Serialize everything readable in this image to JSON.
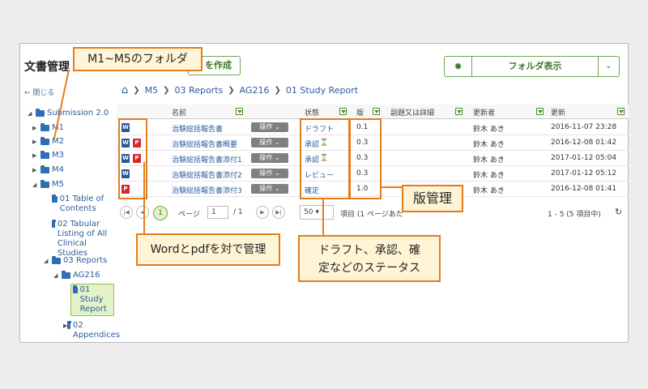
{
  "app": {
    "title": "文書管理",
    "create_label": "を作成",
    "folder_view_label": "フォルダ表示",
    "close_label": "閉じる"
  },
  "breadcrumb": [
    "M5",
    "03 Reports",
    "AG216",
    "01 Study Report"
  ],
  "tree": {
    "submission": "Submission 2.0",
    "m1": "M1",
    "m2": "M2",
    "m3": "M3",
    "m4": "M4",
    "m5": "M5",
    "toc": "01 Table of Contents",
    "tabular": "02 Tabular Listing of All Clinical Studies",
    "reports": "03 Reports",
    "ag216": "AG216",
    "study_report": "01 Study Report",
    "appendices": "02 Appendices"
  },
  "columns": {
    "name": "名前",
    "status": "状態",
    "version": "版",
    "title_detail": "副題又は詳細",
    "updater": "更新者",
    "updated": "更新"
  },
  "op_label": "操作 ⌄",
  "rows": [
    {
      "icons": [
        "W"
      ],
      "name": "治験総括報告書",
      "status": "ドラフト",
      "hourglass": "",
      "version": "0.1",
      "updater": "鈴木 あき",
      "updated": "2016-11-07 23:28"
    },
    {
      "icons": [
        "W",
        "P"
      ],
      "name": "治験総括報告書概要",
      "status": "承認",
      "hourglass": "⌛",
      "version": "0.3",
      "updater": "鈴木 あき",
      "updated": "2016-12-08 01:42"
    },
    {
      "icons": [
        "W",
        "P"
      ],
      "name": "治験総括報告書添付1",
      "status": "承認",
      "hourglass": "⌛",
      "version": "0.3",
      "updater": "鈴木 あき",
      "updated": "2017-01-12 05:04"
    },
    {
      "icons": [
        "W"
      ],
      "name": "治験総括報告書添付2",
      "status": "レビュー",
      "hourglass": "",
      "version": "0.3",
      "updater": "鈴木 あき",
      "updated": "2017-01-12 05:12"
    },
    {
      "icons": [
        "P"
      ],
      "name": "治験総括報告書添付3",
      "status": "確定",
      "hourglass": "",
      "version": "1.0",
      "updater": "鈴木 あき",
      "updated": "2016-12-08 01:41"
    }
  ],
  "pager": {
    "current": "1",
    "page_label": "ページ",
    "page_value": "1",
    "total": "/ 1",
    "page_size": "50",
    "items_label": "項目 (1 ページあた",
    "summary": "1 - 5 (5 項目中)"
  },
  "callouts": {
    "folders": "M1~M5のフォルダ",
    "version": "版管理",
    "word_pdf": "Wordとpdfを対で管理",
    "status_line1": "ドラフト、承認、確",
    "status_line2": "定などのステータス"
  },
  "colors": {
    "accent_green": "#6aa84f",
    "callout_border": "#e57c1c",
    "link_blue": "#2a5d9f"
  }
}
